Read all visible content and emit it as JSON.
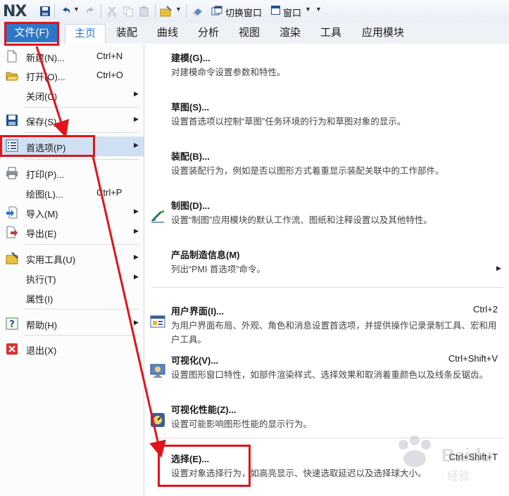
{
  "toolbar": {
    "logo": "NX",
    "switch_window_label": "切换窗口",
    "window_label": "窗口"
  },
  "ribbon": {
    "file_tab": "文件(F)",
    "tabs": [
      "主页",
      "装配",
      "曲线",
      "分析",
      "视图",
      "渲染",
      "工具",
      "应用模块"
    ]
  },
  "file_menu": {
    "items": [
      {
        "label": "新建(N)...",
        "shortcut": "Ctrl+N",
        "icon": "new-file-icon"
      },
      {
        "label": "打开(O)...",
        "shortcut": "Ctrl+O",
        "icon": "open-folder-icon"
      },
      {
        "label": "关闭(C)",
        "shortcut": "",
        "icon": ""
      },
      {
        "label": "保存(S)",
        "shortcut": "",
        "icon": "save-icon"
      },
      {
        "label": "首选项(P)",
        "shortcut": "",
        "icon": "preferences-list-icon"
      },
      {
        "label": "打印(P)...",
        "shortcut": "",
        "icon": "printer-icon"
      },
      {
        "label": "绘图(L)...",
        "shortcut": "Ctrl+P",
        "icon": ""
      },
      {
        "label": "导入(M)",
        "shortcut": "",
        "icon": "import-icon"
      },
      {
        "label": "导出(E)",
        "shortcut": "",
        "icon": "export-icon"
      },
      {
        "label": "实用工具(U)",
        "shortcut": "",
        "icon": "utility-tools-icon"
      },
      {
        "label": "执行(T)",
        "shortcut": "",
        "icon": ""
      },
      {
        "label": "属性(I)",
        "shortcut": "",
        "icon": ""
      },
      {
        "label": "帮助(H)",
        "shortcut": "",
        "icon": "help-icon"
      },
      {
        "label": "退出(X)",
        "shortcut": "",
        "icon": "exit-icon"
      }
    ]
  },
  "preferences": {
    "items": [
      {
        "title": "建模(G)...",
        "desc": "对建模命令设置参数和特性。",
        "shortcut": ""
      },
      {
        "title": "草图(S)...",
        "desc": "设置首选项以控制“草图”任务环境的行为和草图对象的显示。",
        "shortcut": ""
      },
      {
        "title": "装配(B)...",
        "desc": "设置装配行为，例如是否以图形方式着重显示装配关联中的工作部件。",
        "shortcut": ""
      },
      {
        "title": "制图(D)...",
        "desc": "设置“制图”应用模块的默认工作流、图纸和注释设置以及其他特性。",
        "shortcut": ""
      },
      {
        "title": "产品制造信息(M)",
        "desc": "列出“PMI 首选项”命令。",
        "shortcut": ""
      },
      {
        "title": "用户界面(I)...",
        "desc": "为用户界面布局、外观、角色和消息设置首选项，并提供操作记录录制工具、宏和用户工具。",
        "shortcut": "Ctrl+2"
      },
      {
        "title": "可视化(V)...",
        "desc": "设置图形窗口特性，如部件渲染样式、选择效果和取消着重颜色以及线条反锯齿。",
        "shortcut": "Ctrl+Shift+V"
      },
      {
        "title": "可视化性能(Z)...",
        "desc": "设置可能影响图形性能的显示行为。",
        "shortcut": ""
      },
      {
        "title": "选择(E)...",
        "desc": "设置对象选择行为，如高亮显示、快速选取延迟以及选择球大小。",
        "shortcut": "Ctrl+Shift+T"
      }
    ]
  },
  "watermark": "Baidu 经验",
  "colors": {
    "accent": "#2e76c6",
    "highlight": "#cfe0f2",
    "annotation": "#e0141b"
  }
}
